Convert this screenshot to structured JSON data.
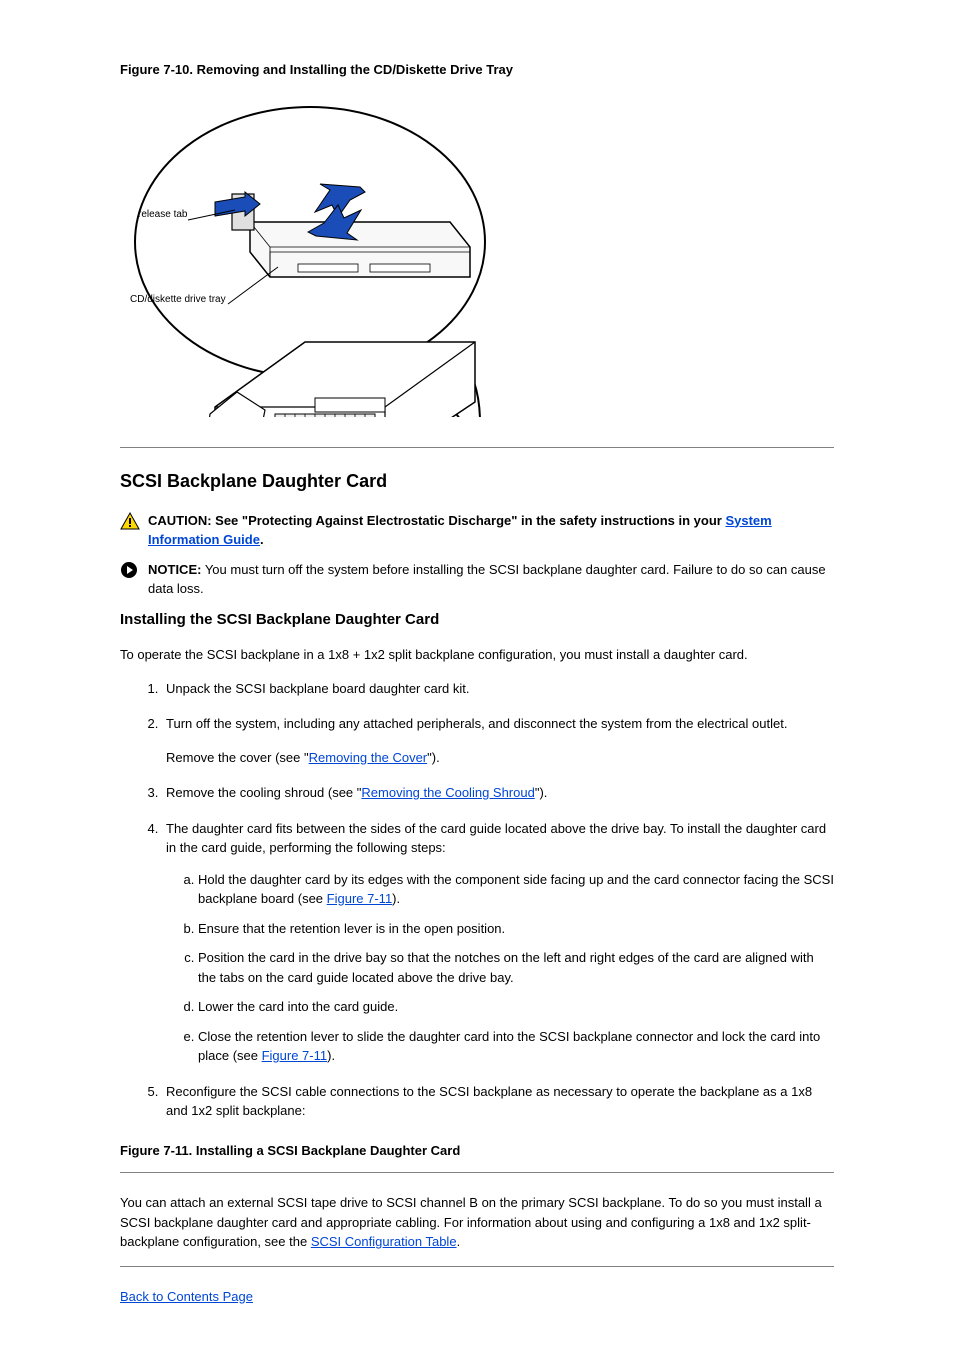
{
  "figure_caption": "Figure 7-10. Removing and Installing the CD/Diskette Drive Tray",
  "figure_labels": {
    "release_tab": "release tab",
    "tray": "CD/diskette drive tray"
  },
  "section_title": "SCSI Backplane Daughter Card",
  "caution_prefix": "CAUTION: See \"Protecting Against Electrostatic Discharge\" in the safety instructions in your ",
  "caution_link": "System Information Guide",
  "caution_suffix": ".",
  "notice_prefix": "NOTICE:",
  "notice_text": " You must turn off the system before installing the SCSI backplane daughter card. Failure to do so can cause data loss.",
  "subsection_title": "Installing the SCSI Backplane Daughter Card",
  "intro_text": "To operate the SCSI backplane in a 1x8 + 1x2 split backplane configuration, you must install a daughter card.",
  "steps": {
    "1": {
      "text": "Unpack the SCSI backplane board daughter card kit."
    },
    "2": {
      "text_a": "Turn off the system, including any attached peripherals, and disconnect the system from the electrical outlet.",
      "text_b": "Remove the cover (see \"",
      "link": "Removing the Cover",
      "text_c": "\")."
    },
    "3": {
      "text_a": "Remove the cooling shroud (see \"",
      "link": "Removing the Cooling Shroud",
      "text_b": "\")."
    },
    "4": {
      "text": "The daughter card fits between the sides of the card guide located above the drive bay. To install the daughter card in the card guide, performing the following steps:",
      "a": {
        "text_a": "Hold the daughter card by its edges with the component side facing up and the card connector facing the SCSI backplane board (see ",
        "link": "Figure 7-11",
        "text_b": ")."
      },
      "b": {
        "text": "Ensure that the retention lever is in the open position."
      },
      "c": {
        "text": "Position the card in the drive bay so that the notches on the left and right edges of the card are aligned with the tabs on the card guide located above the drive bay."
      },
      "d": {
        "text": "Lower the card into the card guide."
      },
      "e": {
        "text_a": "Close the retention lever to slide the daughter card into the SCSI backplane connector and lock the card into place (see ",
        "link": "Figure 7-11",
        "text_b": ")."
      }
    },
    "5": {
      "text": "Reconfigure the SCSI cable connections to the SCSI backplane as necessary to operate the backplane as a 1x8 and 1x2 split backplane:"
    }
  },
  "figure2_caption": "Figure 7-11. Installing a SCSI Backplane Daughter Card",
  "paragraph2": "You can attach an external SCSI tape drive to SCSI channel B on the primary SCSI backplane. To do so you must install a SCSI backplane daughter card and appropriate cabling. For information about using and configuring a 1x8 and 1x2 split-backplane configuration, see the ",
  "paragraph2_link": "SCSI Configuration Table",
  "back_link": "Back to Contents Page"
}
